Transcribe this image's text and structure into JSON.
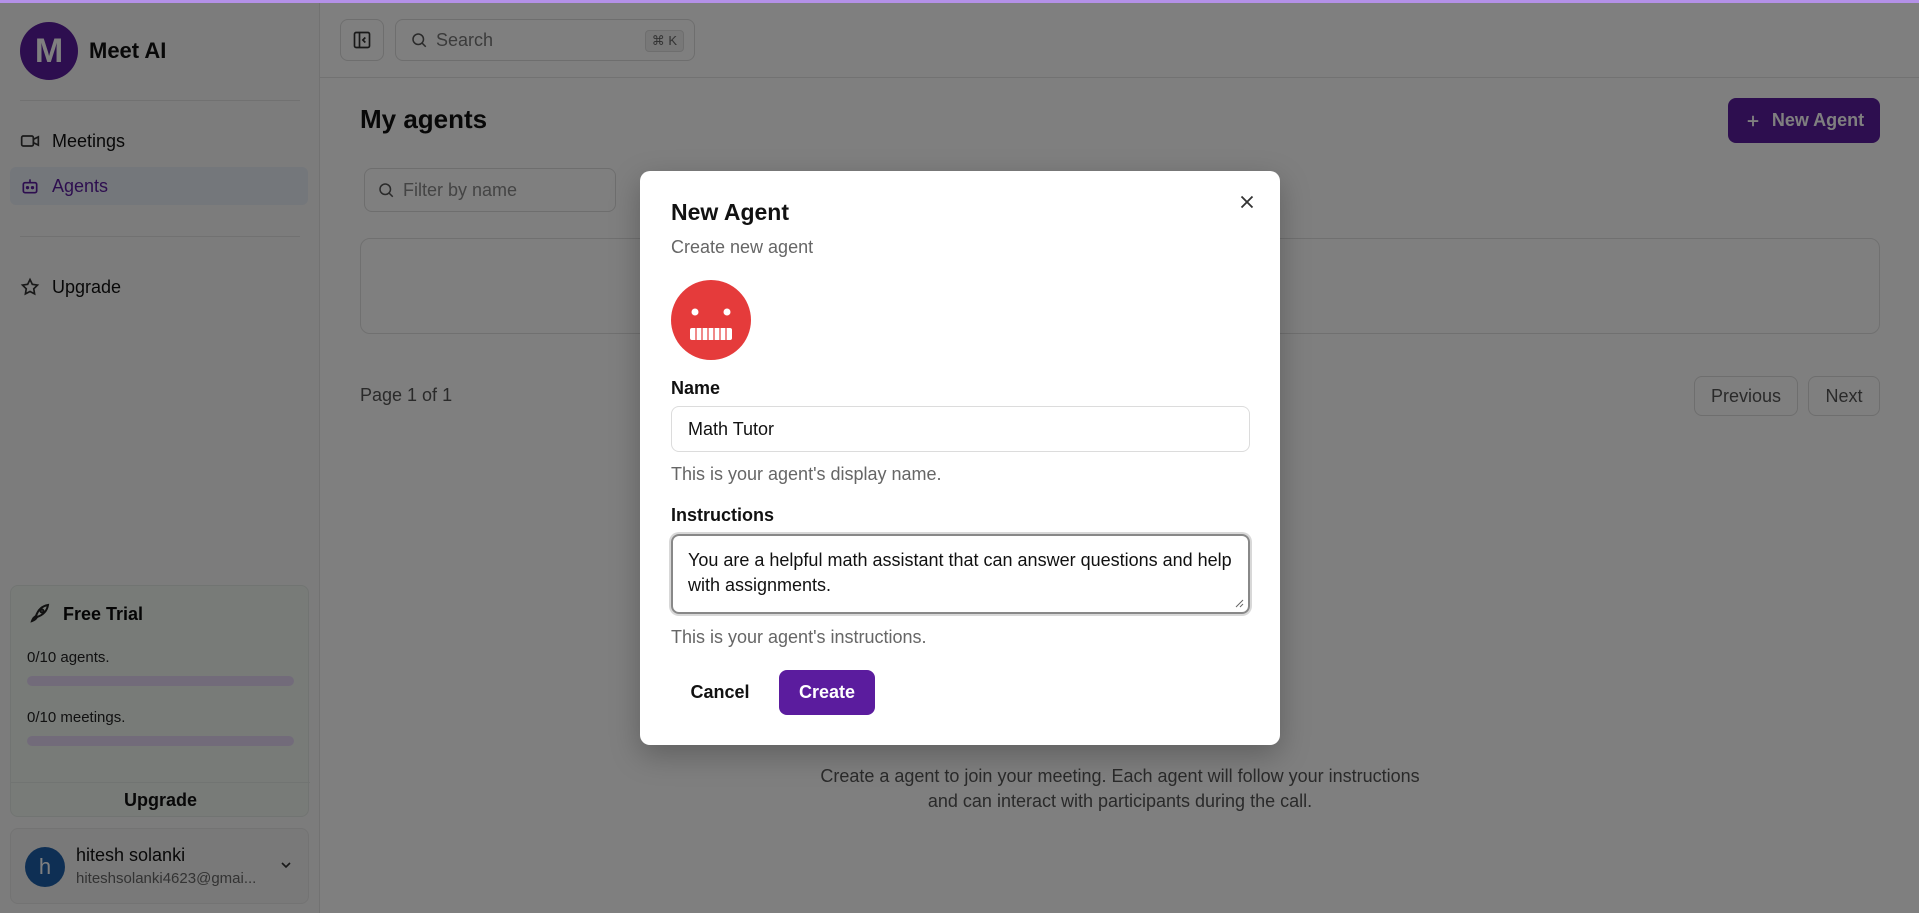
{
  "app": {
    "brand_name": "Meet AI",
    "brand_initial": "M",
    "accent_color": "#5b1c9e"
  },
  "sidebar": {
    "items": [
      {
        "label": "Meetings",
        "icon": "video-icon",
        "active": false
      },
      {
        "label": "Agents",
        "icon": "bot-icon",
        "active": true
      }
    ],
    "upgrade": {
      "label": "Upgrade",
      "icon": "star-icon"
    },
    "trial": {
      "title": "Free Trial",
      "icon": "rocket-icon",
      "agents_text": "0/10 agents.",
      "agents_progress": 0,
      "meetings_text": "0/10 meetings.",
      "meetings_progress": 0,
      "upgrade_label": "Upgrade"
    },
    "user": {
      "initial": "h",
      "name": "hitesh solanki",
      "email": "hiteshsolanki4623@gmai..."
    }
  },
  "topbar": {
    "search_placeholder": "Search",
    "shortcut": "⌘ K"
  },
  "main": {
    "title": "My agents",
    "new_agent_label": "New Agent",
    "filter_placeholder": "Filter by name",
    "page_info": "Page 1 of 1",
    "previous_label": "Previous",
    "next_label": "Next",
    "empty_text": "Create a agent to join your meeting. Each agent will follow your instructions and can interact with participants during the call."
  },
  "modal": {
    "title": "New Agent",
    "subtitle": "Create new agent",
    "name_label": "Name",
    "name_value": "Math Tutor",
    "name_help": "This is your agent's display name.",
    "instructions_label": "Instructions",
    "instructions_value": "You are a helpful math assistant that  can answer questions and help with assignments.",
    "instructions_help": "This is your agent's instructions.",
    "cancel_label": "Cancel",
    "create_label": "Create"
  }
}
